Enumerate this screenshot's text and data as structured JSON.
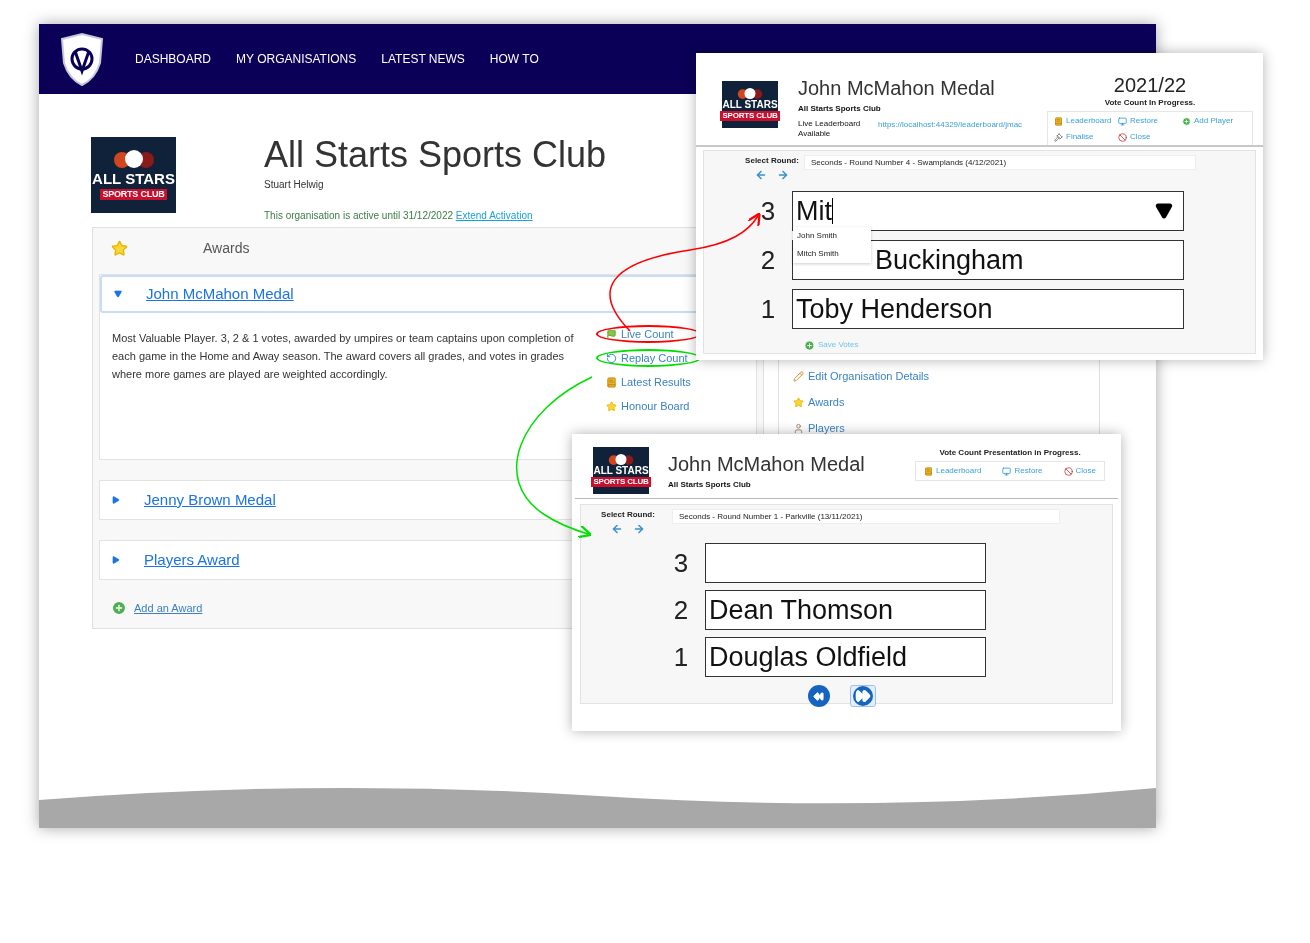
{
  "nav": {
    "items": [
      "DASHBOARD",
      "MY ORGANISATIONS",
      "LATEST NEWS",
      "HOW TO"
    ]
  },
  "organisation": {
    "logo": {
      "line1": "ALL STARS",
      "line2": "SPORTS CLUB"
    },
    "title": "All Starts Sports Club",
    "owner": "Stuart Helwig",
    "status": "This organisation is active until 31/12/2022",
    "link": "Extend Activation"
  },
  "awards_panel": {
    "header": "Awards",
    "awards": [
      {
        "name": "John McMahon Medal",
        "expanded": true,
        "description": "Most Valuable Player. 3, 2 & 1 votes, awarded by umpires or team captains upon completion of each game in the Home and Away season. The award covers all grades, and votes in grades where more games are played are weighted accordingly.",
        "actions": [
          {
            "label": "Live Count",
            "kind": "flag",
            "color": "#ff0000"
          },
          {
            "label": "Replay Count",
            "kind": "replay",
            "color": "#00e000"
          },
          {
            "label": "Latest Results",
            "kind": "book"
          },
          {
            "label": "Honour Board",
            "kind": "star"
          }
        ]
      },
      {
        "name": "Jenny Brown Medal",
        "expanded": false
      },
      {
        "name": "Players Award",
        "expanded": false
      }
    ],
    "add": "Add an Award"
  },
  "side_menu": {
    "items": [
      {
        "label": "Edit Organisation Details",
        "kind": "pencil"
      },
      {
        "label": "Awards",
        "kind": "star"
      },
      {
        "label": "Players",
        "kind": "user"
      }
    ]
  },
  "live_window": {
    "logo": {
      "line1": "ALL STARS",
      "line2": "SPORTS CLUB"
    },
    "title": "John McMahon Medal",
    "club": "All Starts Sports Club",
    "season": "2021/22",
    "status": "Vote Count In Progress.",
    "leaderboard_label": "Live Leaderboard Available",
    "leaderboard_url": "https://localhost:44329/leaderboard/jmac",
    "tools": [
      {
        "label": "Leaderboard",
        "kind": "book"
      },
      {
        "label": "Restore",
        "kind": "monitor"
      },
      {
        "label": "Add Player",
        "kind": "add"
      },
      {
        "label": "Finalise",
        "kind": "gavel"
      },
      {
        "label": "Close",
        "kind": "ban"
      }
    ],
    "select_round": "Select Round:",
    "round": "Seconds - Round Number 4 - Swamplands (4/12/2021)",
    "votes": [
      {
        "points": "3",
        "value": "Mit",
        "kind": "dropdown"
      },
      {
        "points": "2",
        "value": "Buckingham",
        "kind": "covered"
      },
      {
        "points": "1",
        "value": "Toby Henderson",
        "kind": "text"
      }
    ],
    "suggestions": [
      "John Smith",
      "Mitch Smith"
    ],
    "save": "Save Votes"
  },
  "replay_window": {
    "logo": {
      "line1": "ALL STARS",
      "line2": "SPORTS CLUB"
    },
    "title": "John McMahon Medal",
    "club": "All Starts Sports Club",
    "status": "Vote Count Presentation in Progress.",
    "tools": [
      {
        "label": "Leaderboard",
        "kind": "book"
      },
      {
        "label": "Restore",
        "kind": "monitor"
      },
      {
        "label": "Close",
        "kind": "ban"
      }
    ],
    "select_round": "Select Round:",
    "round": "Seconds - Round Number 1 - Parkville (13/11/2021)",
    "votes": [
      {
        "points": "3",
        "kind": "text"
      },
      {
        "points": "2",
        "value": "Dean Thomson",
        "kind": "text"
      },
      {
        "points": "1",
        "value": "Douglas Oldfield",
        "kind": "text"
      }
    ]
  }
}
